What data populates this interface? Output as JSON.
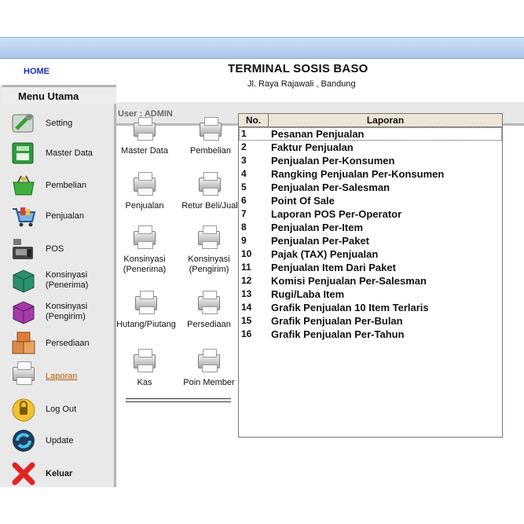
{
  "header": {
    "home_label": "HOME",
    "title": "TERMINAL SOSIS BASO",
    "address": "Jl. Raya Rajawali , Bandung",
    "user_label": "User : ADMIN"
  },
  "sidebar": {
    "title": "Menu Utama",
    "items": [
      {
        "label": "Setting",
        "icon": "setting-icon"
      },
      {
        "label": "Master Data",
        "icon": "master-data-icon"
      },
      {
        "label": "Pembelian",
        "icon": "basket-icon"
      },
      {
        "label": "Penjualan",
        "icon": "shopping-cart-icon"
      },
      {
        "label": "POS",
        "icon": "cash-register-icon"
      },
      {
        "label": "Konsinyasi\n(Penerima)",
        "icon": "green-pallet-icon"
      },
      {
        "label": "Konsinyasi\n(Pengirim)",
        "icon": "purple-pallet-icon"
      },
      {
        "label": "Persediaan",
        "icon": "boxes-icon"
      },
      {
        "label": "Laporan",
        "icon": "printer-icon"
      },
      {
        "label": "Log Out",
        "icon": "lock-icon"
      },
      {
        "label": "Update",
        "icon": "update-icon"
      },
      {
        "label": "Keluar",
        "icon": "red-x-icon"
      }
    ]
  },
  "grid": {
    "items": [
      {
        "label": "Master Data"
      },
      {
        "label": "Pembelian"
      },
      {
        "label": "Penjualan"
      },
      {
        "label": "Retur Beli/Jual"
      },
      {
        "label": "Konsinyasi\n(Penerima)"
      },
      {
        "label": "Konsinyasi\n(Pengirim)"
      },
      {
        "label": "Hutang/Piutang"
      },
      {
        "label": "Persediaan"
      },
      {
        "label": "Kas"
      },
      {
        "label": "Poin Member"
      }
    ]
  },
  "report": {
    "col_no": "No.",
    "col_laporan": "Laporan",
    "rows": [
      {
        "no": "1",
        "name": "Pesanan Penjualan"
      },
      {
        "no": "2",
        "name": "Faktur Penjualan"
      },
      {
        "no": "3",
        "name": "Penjualan Per-Konsumen"
      },
      {
        "no": "4",
        "name": "Rangking Penjualan Per-Konsumen"
      },
      {
        "no": "5",
        "name": "Penjualan Per-Salesman"
      },
      {
        "no": "6",
        "name": "Point Of Sale"
      },
      {
        "no": "7",
        "name": "Laporan POS Per-Operator"
      },
      {
        "no": "8",
        "name": "Penjualan Per-Item"
      },
      {
        "no": "9",
        "name": "Penjualan Per-Paket"
      },
      {
        "no": "10",
        "name": "Pajak (TAX) Penjualan"
      },
      {
        "no": "11",
        "name": "Penjualan Item Dari Paket"
      },
      {
        "no": "12",
        "name": "Komisi Penjualan Per-Salesman"
      },
      {
        "no": "13",
        "name": "Rugi/Laba Item"
      },
      {
        "no": "14",
        "name": "Grafik Penjualan 10 Item Terlaris"
      },
      {
        "no": "15",
        "name": "Grafik Penjualan Per-Bulan"
      },
      {
        "no": "16",
        "name": "Grafik Penjualan Per-Tahun"
      }
    ]
  },
  "colors": {
    "home_link": "#1a2fb8",
    "active_menu": "#c05a00",
    "table_header": "#efe4d8",
    "titlebar": "#a9c6e8"
  }
}
